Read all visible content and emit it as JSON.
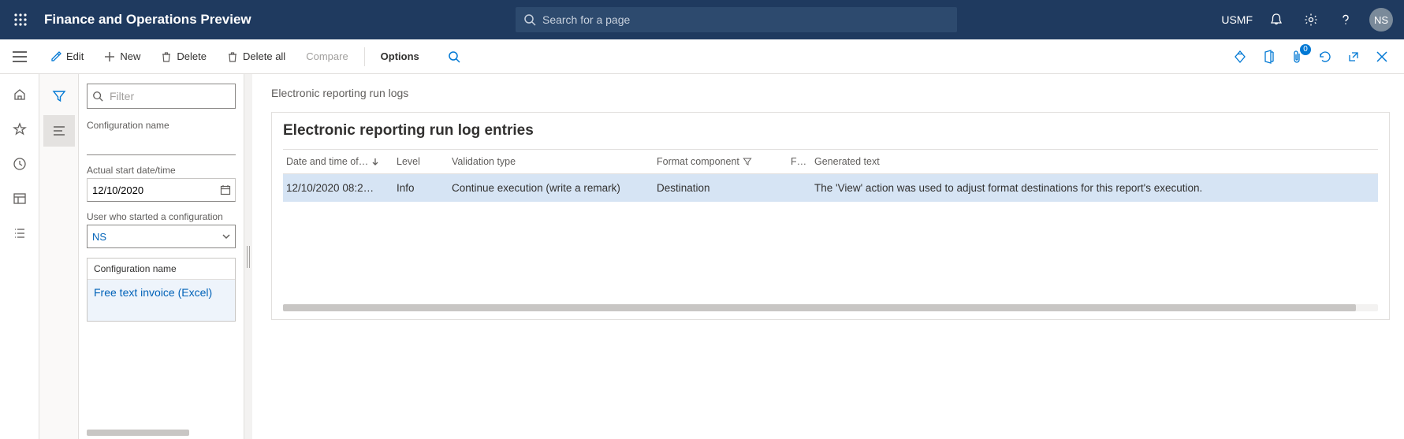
{
  "header": {
    "app_title": "Finance and Operations Preview",
    "search_placeholder": "Search for a page",
    "company": "USMF",
    "user_initials": "NS"
  },
  "actionbar": {
    "edit": "Edit",
    "new": "New",
    "delete": "Delete",
    "delete_all": "Delete all",
    "compare": "Compare",
    "options": "Options",
    "attach_count": "0"
  },
  "sidepanel": {
    "filter_placeholder": "Filter",
    "config_name_label": "Configuration name",
    "config_name_value": "",
    "start_date_label": "Actual start date/time",
    "start_date_value": "12/10/2020",
    "user_label": "User who started a configuration",
    "user_value": "NS",
    "list_header": "Configuration name",
    "list_item": "Free text invoice (Excel)"
  },
  "main": {
    "breadcrumb": "Electronic reporting run logs",
    "card_title": "Electronic reporting run log entries",
    "columns": {
      "datetime": "Date and time of…",
      "level": "Level",
      "validation_type": "Validation type",
      "format_component": "Format component",
      "f": "F…",
      "generated_text": "Generated text"
    },
    "row": {
      "datetime": "12/10/2020 08:2…",
      "level": "Info",
      "validation_type": "Continue execution (write a remark)",
      "format_component": "Destination",
      "f": "",
      "generated_text": "The 'View' action was used to adjust format destinations for this report's execution."
    }
  }
}
